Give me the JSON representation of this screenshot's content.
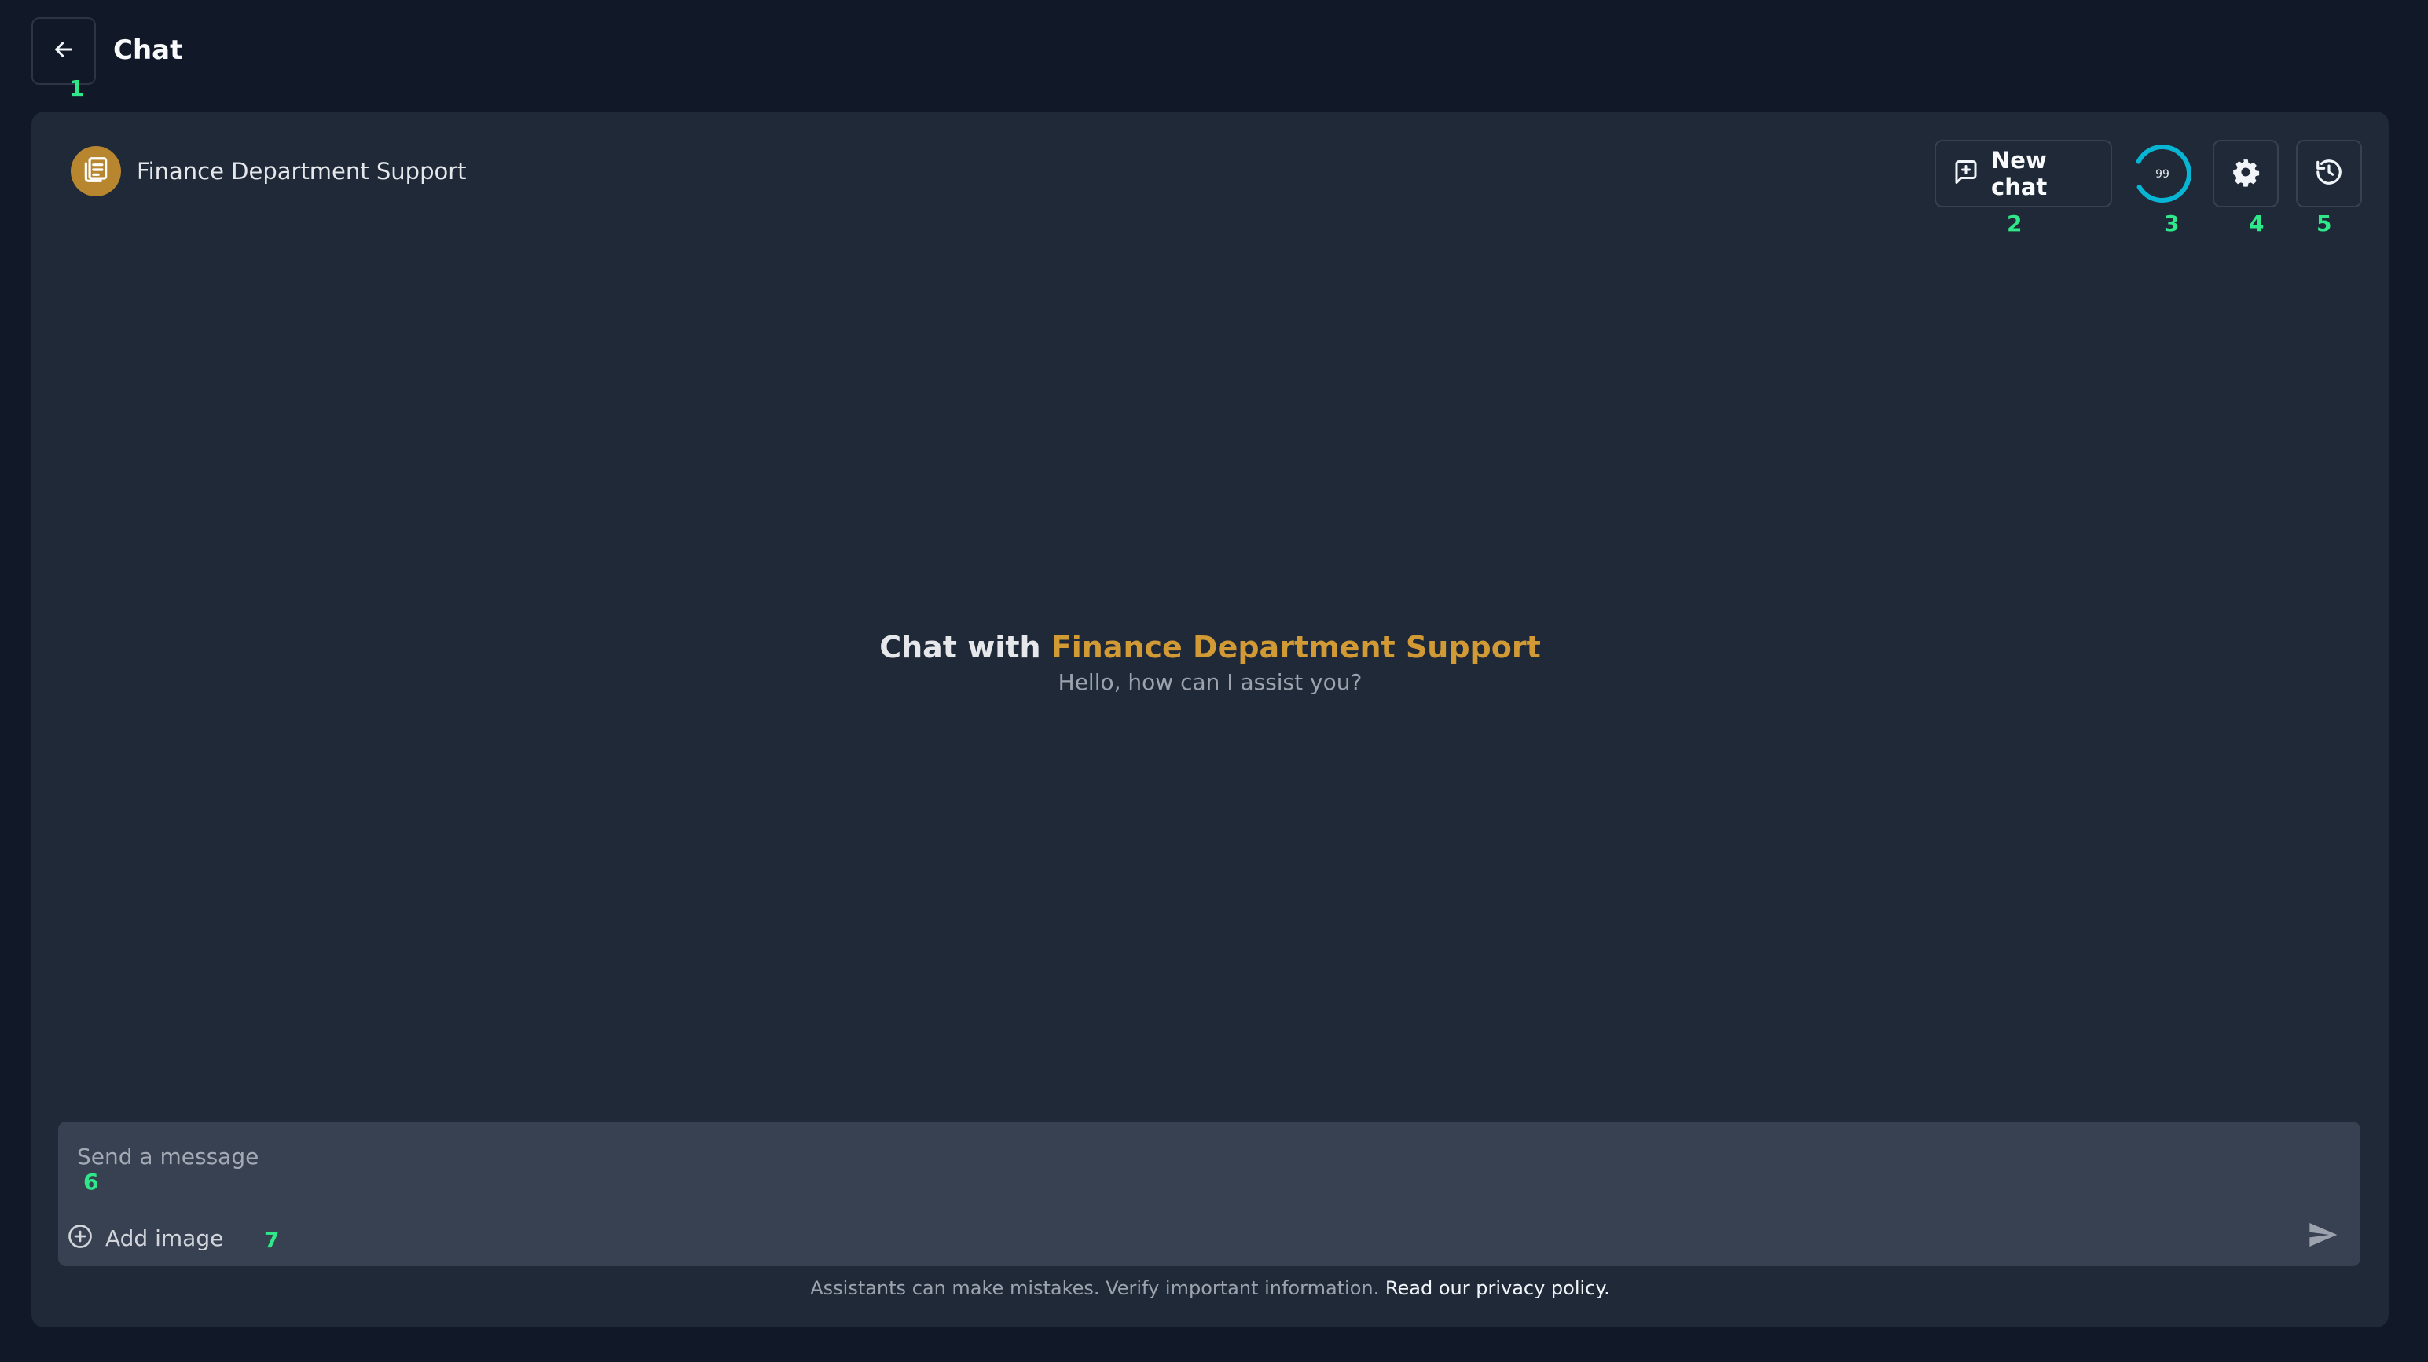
{
  "header": {
    "title": "Chat",
    "back_icon": "arrow-left-icon"
  },
  "assistant": {
    "name": "Finance Department Support",
    "avatar_icon": "document-icon",
    "avatar_color": "#b8862f"
  },
  "toolbar": {
    "new_chat_label": "New chat",
    "new_chat_icon": "plus-square-icon",
    "usage_value": "99",
    "usage_percent": 99,
    "usage_color": "#06b6d4",
    "settings_icon": "gear-icon",
    "history_icon": "history-icon"
  },
  "welcome": {
    "prefix": "Chat with",
    "assistant_name": "Finance Department Support",
    "subtitle": "Hello, how can I assist you?"
  },
  "composer": {
    "placeholder": "Send a message",
    "value": "",
    "add_image_label": "Add image",
    "send_icon": "send-icon"
  },
  "footer": {
    "disclaimer": "Assistants can make mistakes. Verify important information.",
    "privacy_link": "Read our privacy policy."
  },
  "markers": [
    "1",
    "2",
    "3",
    "4",
    "5",
    "6",
    "7"
  ],
  "colors": {
    "background": "#111827",
    "panel": "#1f2937",
    "accent": "#d29a35",
    "marker": "#2ee88a"
  }
}
